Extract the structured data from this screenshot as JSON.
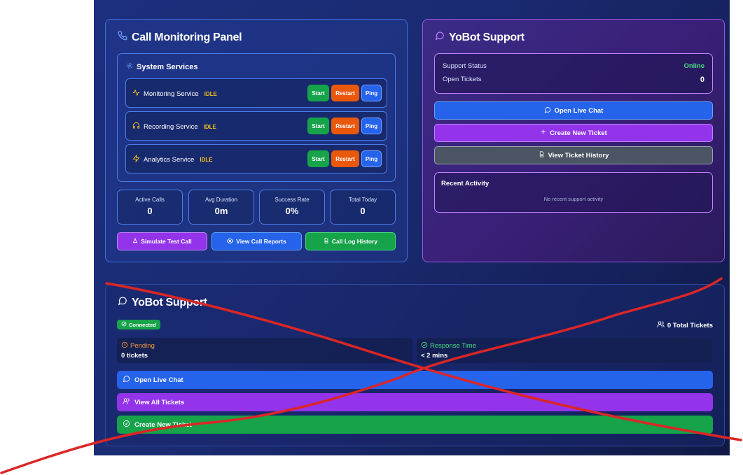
{
  "call_panel": {
    "title": "Call Monitoring Panel",
    "services_title": "System Services",
    "services": [
      {
        "name": "Monitoring Service",
        "status": "IDLE"
      },
      {
        "name": "Recording Service",
        "status": "IDLE"
      },
      {
        "name": "Analytics Service",
        "status": "IDLE"
      }
    ],
    "service_buttons": {
      "start": "Start",
      "restart": "Restart",
      "ping": "Ping"
    },
    "stats": [
      {
        "label": "Active Calls",
        "value": "0"
      },
      {
        "label": "Avg Duration",
        "value": "0m"
      },
      {
        "label": "Success Rate",
        "value": "0%"
      },
      {
        "label": "Total Today",
        "value": "0"
      }
    ],
    "actions": {
      "simulate": "Simulate Test Call",
      "reports": "View Call Reports",
      "history": "Call Log History"
    }
  },
  "support_panel": {
    "title": "YoBot Support",
    "status_label": "Support Status",
    "status_value": "Online",
    "tickets_label": "Open Tickets",
    "tickets_value": "0",
    "open_chat": "Open Live Chat",
    "new_ticket": "Create New Ticket",
    "ticket_history": "View Ticket History",
    "recent_title": "Recent Activity",
    "recent_empty": "No recent support activity"
  },
  "support_widget": {
    "title": "YoBot Support",
    "connected": "Connected",
    "total_tickets": "0 Total Tickets",
    "pending_label": "Pending",
    "pending_value": "0 tickets",
    "response_label": "Response Time",
    "response_value": "< 2 mins",
    "open_chat": "Open Live Chat",
    "view_all": "View All Tickets",
    "create_new": "Create New Ticket"
  },
  "colors": {
    "background": "#1b2b72",
    "start": "#16a34a",
    "restart": "#ea580c",
    "ping": "#2563eb",
    "purple": "#9333ea",
    "online": "#4ade80",
    "idle": "#f6c21a",
    "scribble": "#dc2626"
  }
}
